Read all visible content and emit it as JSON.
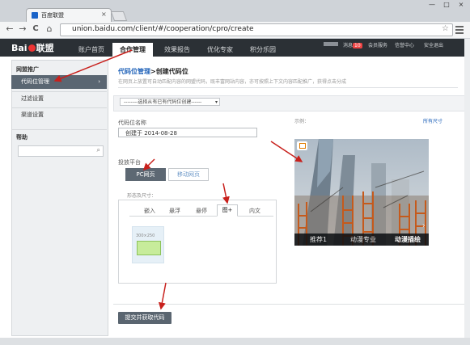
{
  "browser": {
    "tab_title": "百度联盟",
    "tab_close": "×",
    "url": "union.baidu.com/client/#/cooperation/cpro/create",
    "back": "←",
    "forward": "→",
    "reload": "C",
    "home": "⌂",
    "star": "☆",
    "minimize": "—",
    "maximize": "□",
    "close": "×"
  },
  "header": {
    "logo_text_a": "Bai",
    "logo_text_b": "联盟",
    "nav": [
      {
        "label": "账户首页",
        "active": false
      },
      {
        "label": "合作管理",
        "active": true
      },
      {
        "label": "效果报告",
        "active": false
      },
      {
        "label": "优化专家",
        "active": false
      },
      {
        "label": "积分乐园",
        "active": false
      }
    ],
    "links": {
      "message": "消息",
      "message_count": "10",
      "member": "会员服务",
      "credit": "信誉中心",
      "logout": "安全退出"
    }
  },
  "sidebar": {
    "section1": "网盟推广",
    "items": [
      {
        "label": "代码位管理",
        "active": true
      },
      {
        "label": "过滤设置",
        "active": false
      },
      {
        "label": "渠道设置",
        "active": false
      }
    ],
    "active_chevron": "›",
    "section2": "帮助",
    "search_icon": "⌕"
  },
  "main": {
    "breadcrumb_link": "代码位管理",
    "breadcrumb_current": ">创建代码位",
    "description": "在网页上放置可自动匹配内容的网盟代码，既丰富网站内容，亦可按照上下文内容匹配推广，获得点击分成",
    "select_placeholder": "--------选择从有已有代码位创建------",
    "name_label": "代码位名称",
    "name_value": "创建于 2014-08-28",
    "platform_label": "投放平台",
    "platforms": [
      "PC网页",
      "移动网页"
    ],
    "style_label": "形态及尺寸：",
    "style_tabs": [
      "嵌入",
      "悬浮",
      "悬停",
      "图+",
      "内文"
    ],
    "thumb_size": "300×250",
    "submit": "提交并获取代码",
    "example_label": "示例：",
    "all_sizes": "所有尺寸",
    "preview_captions": [
      "推荐1",
      "动漫专业",
      "动漫插绘"
    ],
    "next_arrow": "›"
  }
}
